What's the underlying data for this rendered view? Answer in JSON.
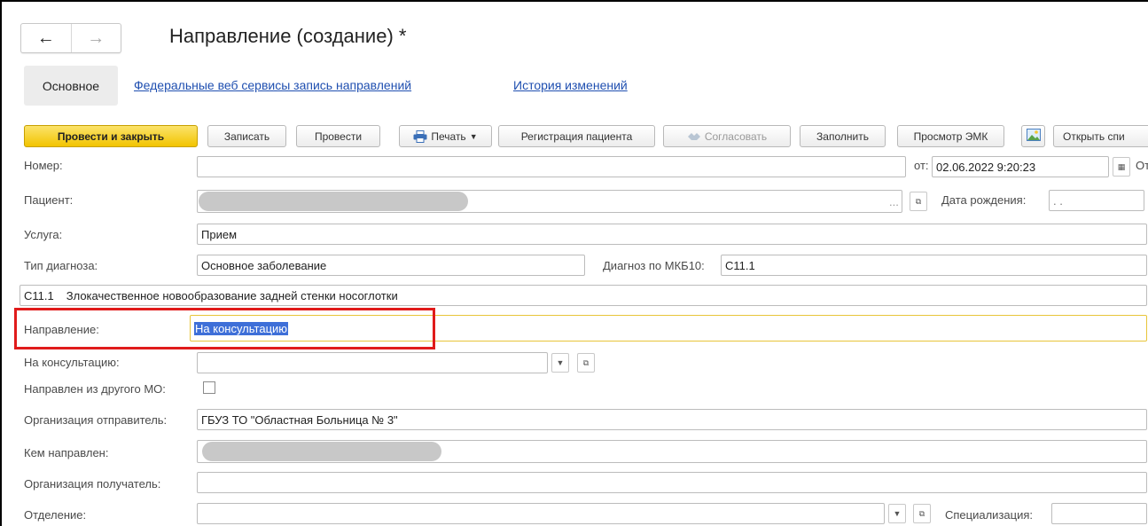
{
  "header": {
    "title": "Направление (создание) *",
    "back_icon": "arrow-left-icon",
    "forward_icon": "arrow-right-icon"
  },
  "tabs": {
    "active": "Основное",
    "links": [
      "Федеральные веб сервисы запись направлений",
      "История изменений"
    ]
  },
  "toolbar": {
    "post_close": "Провести и закрыть",
    "write": "Записать",
    "post": "Провести",
    "print": "Печать",
    "register_patient": "Регистрация пациента",
    "approve": "Согласовать",
    "fill": "Заполнить",
    "view_emk": "Просмотр ЭМК",
    "open_list": "Открыть спи"
  },
  "form": {
    "number_label": "Номер:",
    "number_value": "",
    "date_from_label": "от:",
    "date_value": "02.06.2022  9:20:23",
    "date_cut_label": "От",
    "patient_label": "Пациент:",
    "birth_date_label": "Дата рождения:",
    "birth_date_value": " .  .",
    "service_label": "Услуга:",
    "service_value": "Прием",
    "diag_type_label": "Тип диагноза:",
    "diag_type_value": "Основное заболевание",
    "mkb_label": "Диагноз по МКБ10:",
    "mkb_value": "C11.1",
    "diag_code": "C11.1",
    "diag_text": "Злокачественное новообразование задней стенки носоглотки",
    "direction_label": "Направление:",
    "direction_value": "На консультацию",
    "consult_label": "На консультацию:",
    "consult_value": "",
    "other_mo_label": "Направлен из другого МО:",
    "sender_org_label": "Организация отправитель:",
    "sender_org_value": "ГБУЗ ТО \"Областная Больница № 3\"",
    "sent_by_label": "Кем направлен:",
    "receiver_org_label": "Организация получатель:",
    "receiver_org_value": "",
    "department_label": "Отделение:",
    "department_value": "",
    "specialization_label": "Специализация:"
  },
  "colors": {
    "primary_button": "#f2c400",
    "link": "#1f4fb0",
    "highlight": "#e01b1b",
    "focus_border": "#e8c53a",
    "selection": "#3e6fd8"
  }
}
